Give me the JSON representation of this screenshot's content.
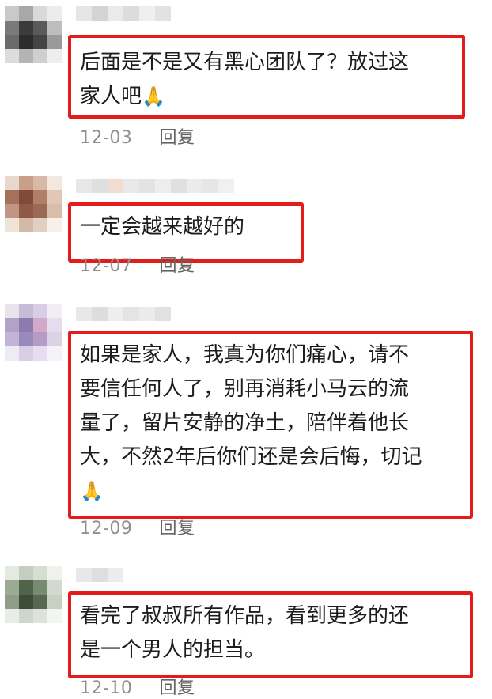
{
  "comments": [
    {
      "text": "后面是不是又有黑心团队了？放过这\n家人吧",
      "emoji": "🙏",
      "date": "12-03",
      "reply": "回复"
    },
    {
      "text": "一定会越来越好的",
      "emoji": "",
      "date": "12-07",
      "reply": "回复"
    },
    {
      "text": "如果是家人，我真为你们痛心，请不\n要信任何人了，别再消耗小马云的流\n量了，留片安静的净土，陪伴着他长\n大，不然2年后你们还是会后悔，切记\n",
      "emoji": "🙏",
      "date": "12-09",
      "reply": "回复"
    },
    {
      "text": "看完了叔叔所有作品，看到更多的还\n是一个男人的担当。",
      "emoji": "",
      "date": "12-10",
      "reply": "回复"
    }
  ],
  "colors": {
    "highlight_border": "#e31b1b",
    "date": "#8f8f8f"
  }
}
